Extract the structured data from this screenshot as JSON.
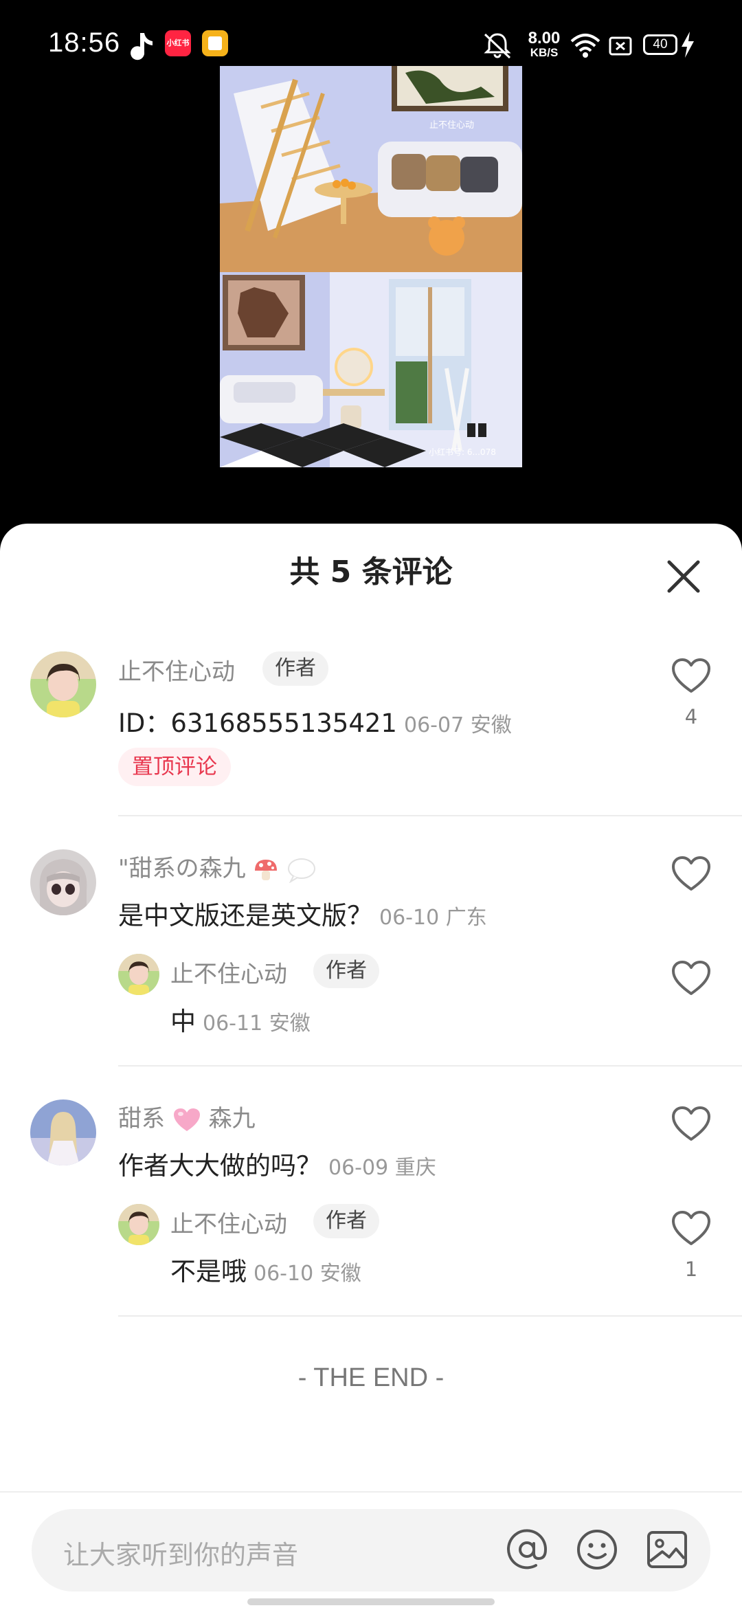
{
  "status_bar": {
    "time": "18:56",
    "xhs_badge": "小红书",
    "net_speed_value": "8.00",
    "net_speed_unit": "KB/S",
    "battery": "40"
  },
  "video": {
    "overlay_watermark": "止不住心动",
    "overlay_id": "小红书号: 6...078"
  },
  "sheet": {
    "title": "共 5 条评论"
  },
  "comments": [
    {
      "user": "止不住心动",
      "tag": "作者",
      "text": "ID：63168555135421",
      "date": "06-07 安徽",
      "pin": "置顶评论",
      "likes": "4"
    },
    {
      "user": "\"甜系の森九",
      "text": "是中文版还是英文版？",
      "date": "06-10 广东",
      "reply": {
        "user": "止不住心动",
        "tag": "作者",
        "text": "中",
        "date": "06-11 安徽"
      }
    },
    {
      "user_part1": "甜系",
      "user_part2": "森九",
      "text": "作者大大做的吗？",
      "date": "06-09 重庆",
      "reply": {
        "user": "止不住心动",
        "tag": "作者",
        "text": "不是哦",
        "date": "06-10 安徽",
        "likes": "1"
      }
    }
  ],
  "end_text": "- THE END -",
  "input": {
    "placeholder": "让大家听到你的声音"
  },
  "colors": {
    "accent": "#e8384f",
    "pin_bg": "#fff0f2",
    "sheet_bg": "#ffffff"
  }
}
